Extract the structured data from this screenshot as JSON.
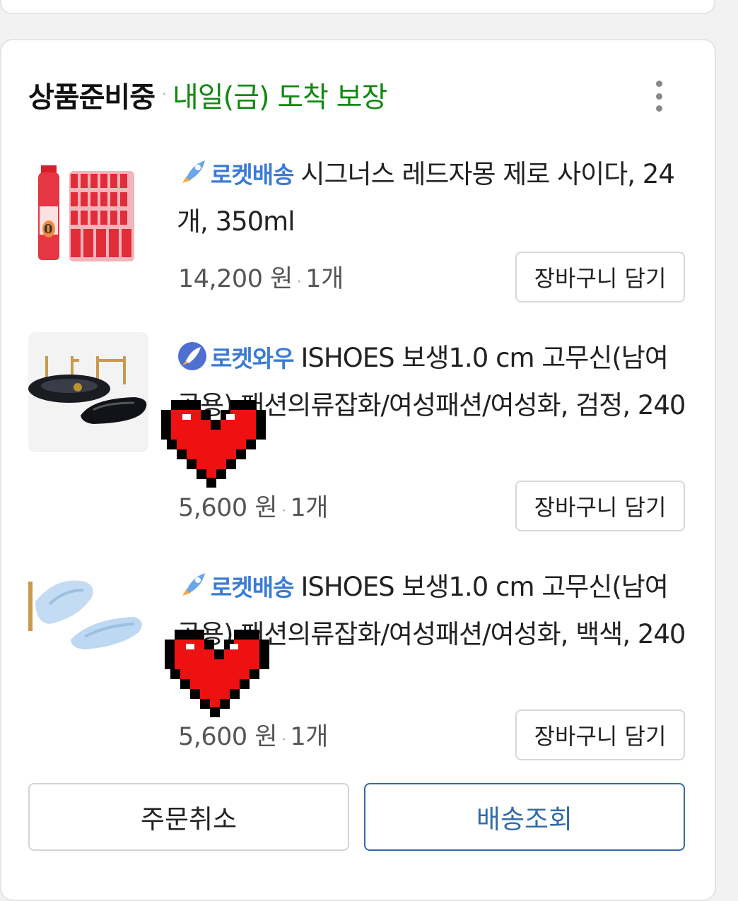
{
  "header": {
    "status": "상품준비중",
    "separator": "·",
    "delivery": "내일(금) 도착 보장",
    "delivery_color": "#118a11"
  },
  "items": [
    {
      "badge": "로켓배송",
      "badge_icon": "rocket-icon",
      "title": "시그너스 레드자몽 제로 사이다, 24개, 350ml",
      "price": "14,200 원",
      "quantity": "1개",
      "cart_label": "장바구니 담기"
    },
    {
      "badge": "로켓와우",
      "badge_icon": "rocket-wow-icon",
      "title": "ISHOES 보생1.0 cm 고무신(남여공용) 패션의류잡화/여성패션/여성화, 검정, 240",
      "price": "5,600 원",
      "quantity": "1개",
      "cart_label": "장바구니 담기"
    },
    {
      "badge": "로켓배송",
      "badge_icon": "rocket-icon",
      "title": "ISHOES 보생1.0 cm 고무신(남여공용) 패션의류잡화/여성패션/여성화, 백색, 240",
      "price": "5,600 원",
      "quantity": "1개",
      "cart_label": "장바구니 담기"
    }
  ],
  "actions": {
    "cancel_label": "주문취소",
    "track_label": "배송조회",
    "track_color": "#346aa8"
  },
  "badge_color": "#3a7bd5"
}
